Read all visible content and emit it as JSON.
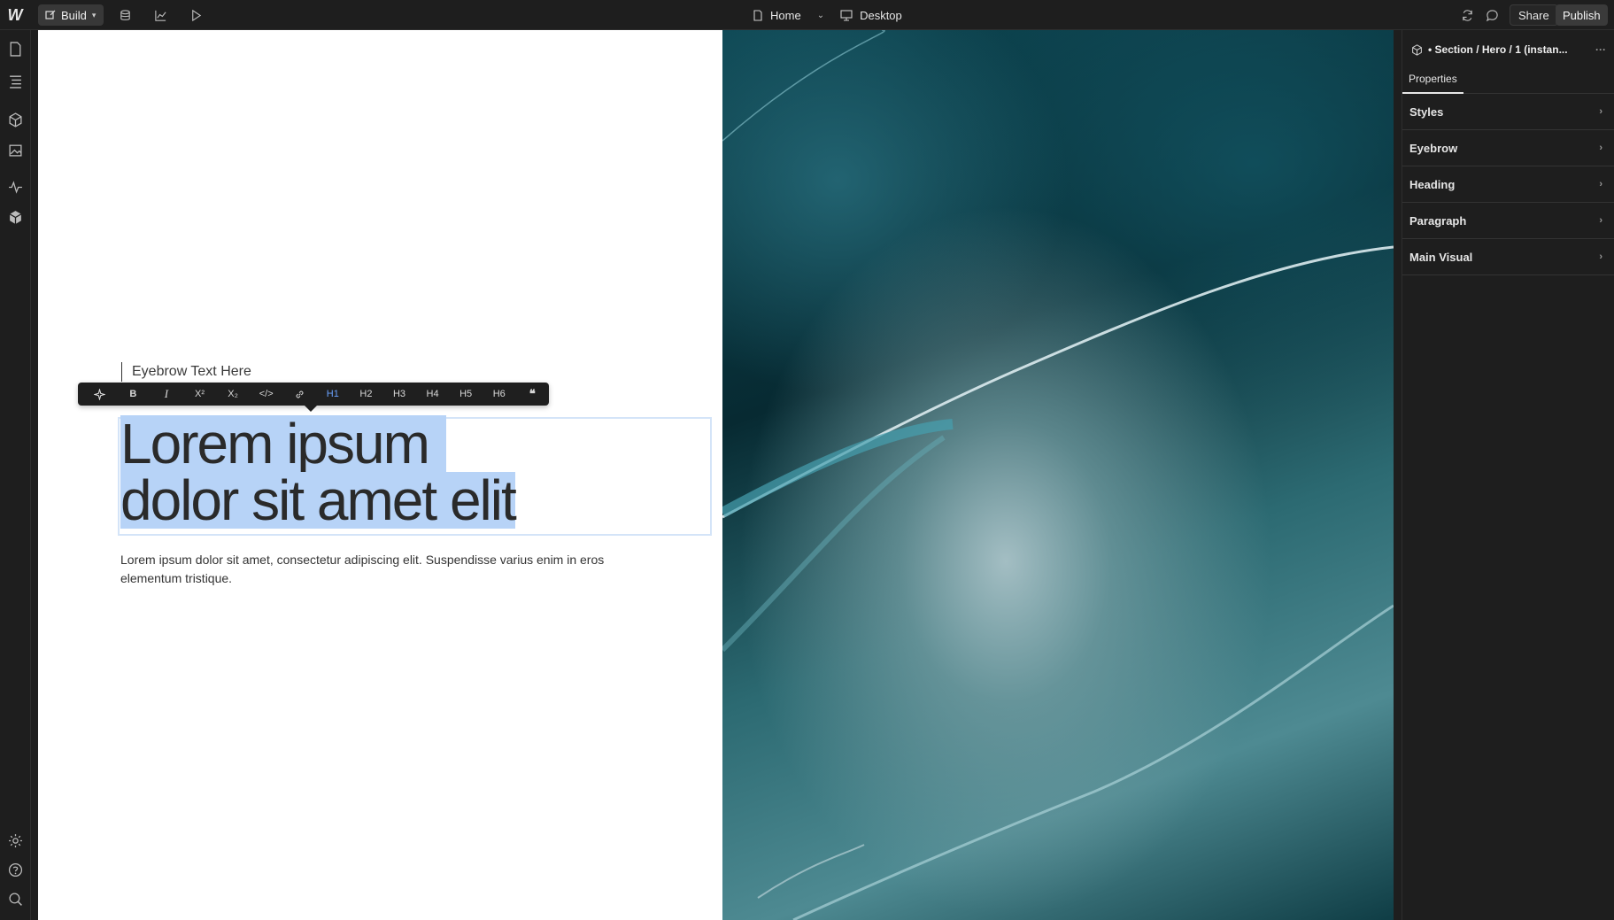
{
  "topbar": {
    "mode_label": "Build",
    "page_label": "Home",
    "device_label": "Desktop",
    "share_label": "Share",
    "publish_label": "Publish"
  },
  "canvas": {
    "eyebrow": "Eyebrow Text Here",
    "heading_line1": "Lorem ipsum",
    "heading_line2": "dolor sit amet elit",
    "paragraph": "Lorem ipsum dolor sit amet, consectetur adipiscing elit. Suspendisse varius enim in eros elementum tristique."
  },
  "format_toolbar": {
    "bold": "B",
    "italic": "I",
    "superscript": "X²",
    "subscript": "X₂",
    "code": "</>",
    "h1": "H1",
    "h2": "H2",
    "h3": "H3",
    "h4": "H4",
    "h5": "H5",
    "h6": "H6",
    "quote": "❝"
  },
  "right_panel": {
    "title": "• Section / Hero / 1 (instan...",
    "tab": "Properties",
    "sections": [
      "Styles",
      "Eyebrow",
      "Heading",
      "Paragraph",
      "Main Visual"
    ]
  },
  "colors": {
    "selection": "#b7d3f7",
    "active_heading": "#6aa2ff",
    "panel_bg": "#1e1e1e"
  }
}
